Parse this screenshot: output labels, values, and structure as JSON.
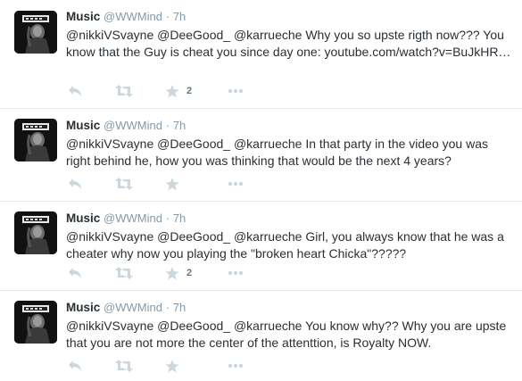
{
  "tweets": [
    {
      "name": "Music",
      "handle": "@WWMind",
      "separator": "·",
      "time": "7h",
      "text": "@nikkiVSvayne @DeeGood_ @karrueche Why you so upste rigth now??? You know that the Guy is cheat you since day one: youtube.com/watch?v=BuJkHR…",
      "favorite_count": "2"
    },
    {
      "name": "Music",
      "handle": "@WWMind",
      "separator": "·",
      "time": "7h",
      "text": "@nikkiVSvayne @DeeGood_ @karrueche In that party in the video you was right behind he, how you was thinking that would be the next 4 years?",
      "favorite_count": ""
    },
    {
      "name": "Music",
      "handle": "@WWMind",
      "separator": "·",
      "time": "7h",
      "text": "@nikkiVSvayne @DeeGood_ @karrueche Girl, you always know that he was a cheater why now you playing the \"broken heart Chicka\"?????",
      "favorite_count": "2"
    },
    {
      "name": "Music",
      "handle": "@WWMind",
      "separator": "·",
      "time": "7h",
      "text": "@nikkiVSvayne @DeeGood_ @karrueche You know why?? Why you are upste that you are not more the center of the attenttion, is Royalty NOW.",
      "favorite_count": ""
    }
  ],
  "icons": {
    "reply": "reply-icon",
    "retweet": "retweet-icon",
    "favorite": "star-icon",
    "more": "more-icon"
  },
  "colors": {
    "icon": "#ccd6dd",
    "meta": "#8899a6",
    "text": "#292f33",
    "divider": "#e1e8ed"
  }
}
